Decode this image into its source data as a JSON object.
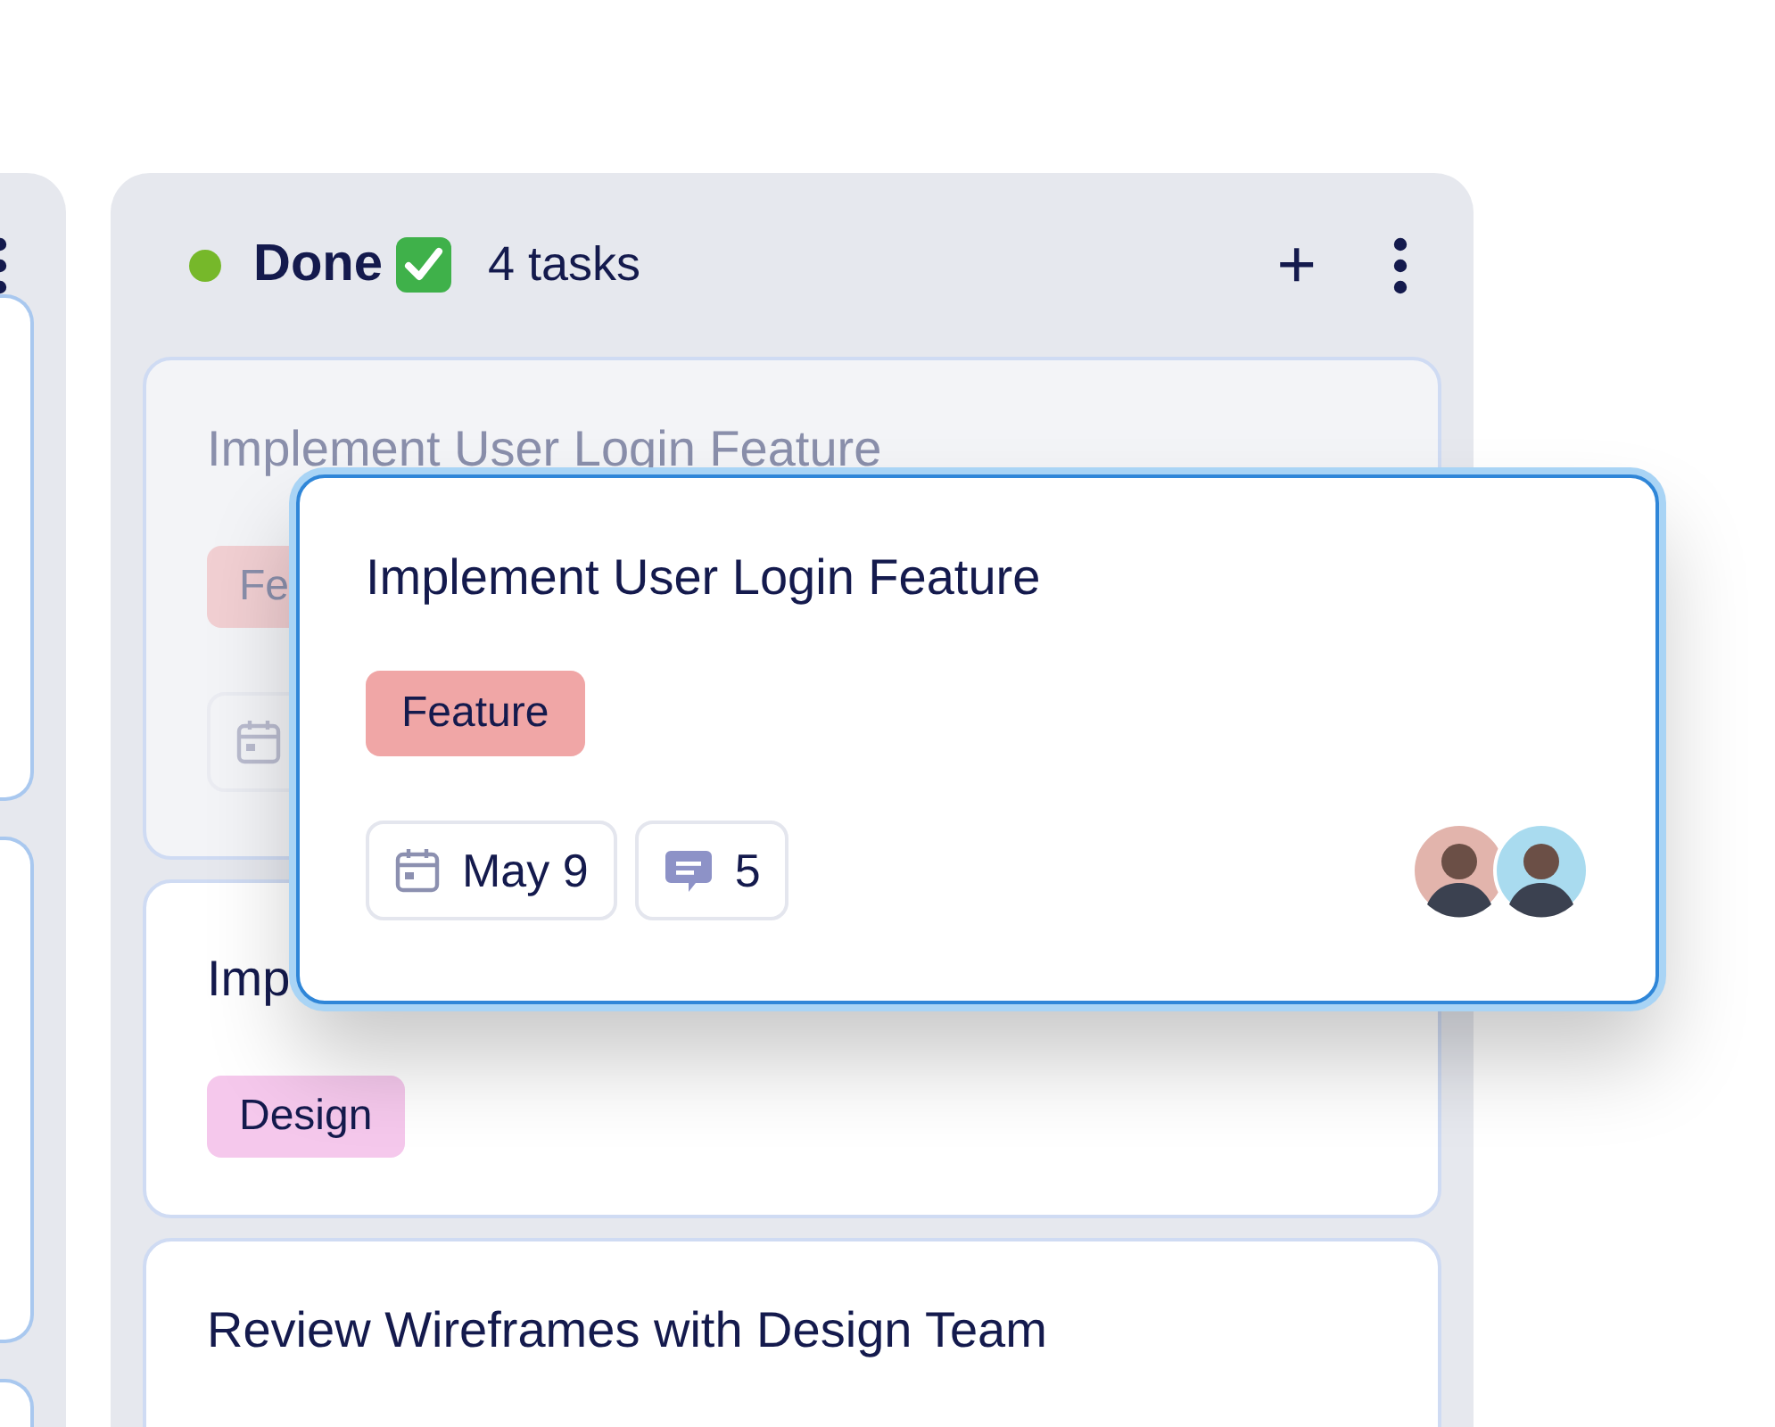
{
  "column": {
    "title": "Done",
    "color": "#76b82a",
    "count": "4 tasks",
    "add_label": "+",
    "cards": [
      {
        "kind": "ghost",
        "title": "Implement User Login Feature",
        "tags": [
          {
            "label": "Fe",
            "color": "#f1cfd2"
          }
        ]
      },
      {
        "kind": "card",
        "title": "Imp",
        "tags": [
          {
            "label": "Design",
            "color": "#f5c8ec"
          }
        ]
      },
      {
        "kind": "card",
        "title": "Review Wireframes with Design Team"
      }
    ]
  },
  "dragged_card": {
    "title": "Implement User Login Feature",
    "tags": [
      {
        "label": "Feature",
        "color": "#f0a6a6"
      }
    ],
    "date": "May 9",
    "comments": "5",
    "assignees": [
      {
        "color": "#e2b4ac"
      },
      {
        "color": "#a9dbef"
      }
    ]
  }
}
